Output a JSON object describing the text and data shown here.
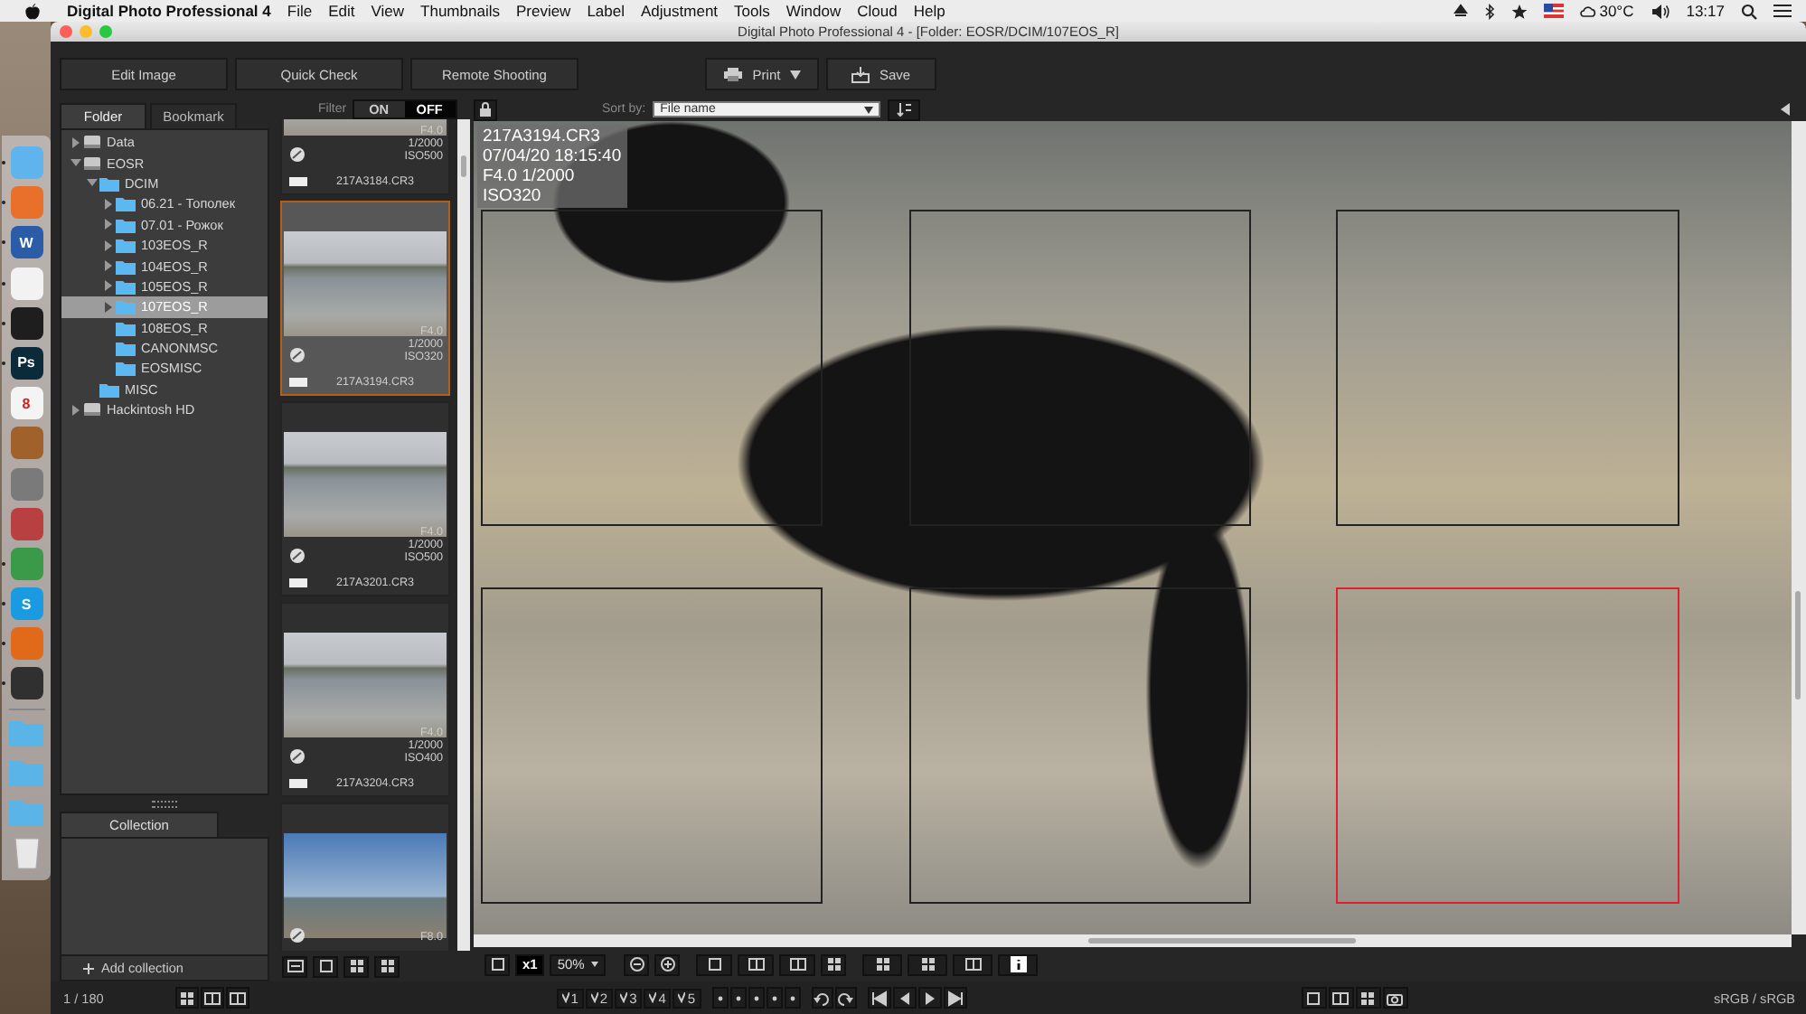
{
  "menubar": {
    "app_name": "Digital Photo Professional 4",
    "items": [
      "File",
      "Edit",
      "View",
      "Thumbnails",
      "Preview",
      "Label",
      "Adjustment",
      "Tools",
      "Window",
      "Cloud",
      "Help"
    ],
    "weather": "30°C",
    "time": "13:17"
  },
  "dock": [
    {
      "kind": "app",
      "color": "#5fb4ee",
      "running": true
    },
    {
      "kind": "app",
      "color": "#e8702a",
      "running": true
    },
    {
      "kind": "app",
      "color": "#2b5ca8",
      "running": true,
      "label": "W"
    },
    {
      "kind": "app",
      "color": "#f2f2f2",
      "running": true
    },
    {
      "kind": "app",
      "color": "#1e1e1e",
      "running": true
    },
    {
      "kind": "app",
      "color": "#0b2b3b",
      "running": true,
      "label": "Ps"
    },
    {
      "kind": "app",
      "color": "#f4f4f4",
      "running": false,
      "label": "8"
    },
    {
      "kind": "app",
      "color": "#a0622a",
      "running": false
    },
    {
      "kind": "app",
      "color": "#7a7a7a",
      "running": false
    },
    {
      "kind": "app",
      "color": "#b84040",
      "running": false
    },
    {
      "kind": "app",
      "color": "#3a9a4a",
      "running": true
    },
    {
      "kind": "app",
      "color": "#1a9ae0",
      "running": true,
      "label": "S"
    },
    {
      "kind": "app",
      "color": "#e06a1a",
      "running": true
    },
    {
      "kind": "app",
      "color": "#303030",
      "running": true
    },
    {
      "kind": "folder",
      "color": "#5ab4e8",
      "running": false
    },
    {
      "kind": "folder",
      "color": "#5ab4e8",
      "running": false
    },
    {
      "kind": "folder",
      "color": "#5ab4e8",
      "running": false
    },
    {
      "kind": "trash",
      "color": "#e8e8e8",
      "running": false
    }
  ],
  "window": {
    "title": "Digital Photo Professional 4 - [Folder: EOSR/DCIM/107EOS_R]"
  },
  "toolbar": {
    "buttons": [
      "Edit Image",
      "Quick Check",
      "Remote Shooting"
    ],
    "print": "Print",
    "save": "Save"
  },
  "sidebar": {
    "tabs": [
      {
        "label": "Folder",
        "selected": true
      },
      {
        "label": "Bookmark",
        "selected": false
      }
    ],
    "tree": [
      {
        "label": "Data",
        "kind": "drive",
        "expandable": true,
        "expanded": false,
        "selected": false
      },
      {
        "label": "EOSR",
        "kind": "drive",
        "expandable": true,
        "expanded": true,
        "selected": false,
        "children": [
          {
            "label": "DCIM",
            "kind": "folder",
            "expandable": true,
            "expanded": true,
            "selected": false,
            "children": [
              {
                "label": "06.21 - Тополек",
                "kind": "folder",
                "expandable": true,
                "expanded": false,
                "selected": false
              },
              {
                "label": "07.01 - Рожок",
                "kind": "folder",
                "expandable": true,
                "expanded": false,
                "selected": false
              },
              {
                "label": "103EOS_R",
                "kind": "folder",
                "expandable": true,
                "expanded": false,
                "selected": false
              },
              {
                "label": "104EOS_R",
                "kind": "folder",
                "expandable": true,
                "expanded": false,
                "selected": false
              },
              {
                "label": "105EOS_R",
                "kind": "folder",
                "expandable": true,
                "expanded": false,
                "selected": false
              },
              {
                "label": "107EOS_R",
                "kind": "folder",
                "expandable": true,
                "expanded": false,
                "selected": true
              },
              {
                "label": "108EOS_R",
                "kind": "folder",
                "expandable": false,
                "selected": false
              },
              {
                "label": "CANONMSC",
                "kind": "folder",
                "expandable": false,
                "selected": false
              },
              {
                "label": "EOSMISC",
                "kind": "folder",
                "expandable": false,
                "selected": false
              }
            ]
          },
          {
            "label": "MISC",
            "kind": "folder",
            "expandable": false,
            "selected": false
          }
        ]
      },
      {
        "label": "Hackintosh HD",
        "kind": "drive",
        "expandable": true,
        "expanded": false,
        "selected": false
      }
    ],
    "collection": {
      "tab": "Collection",
      "add": "Add collection"
    }
  },
  "filter": {
    "label": "Filter",
    "options": [
      {
        "label": "ON",
        "selected": false
      },
      {
        "label": "OFF",
        "selected": true
      }
    ]
  },
  "sort": {
    "label": "Sort by:",
    "value": "File name"
  },
  "thumbnails": [
    {
      "exposure": [
        "F4.0",
        "1/2000",
        "ISO500"
      ],
      "filename": "217A3184.CR3",
      "selected": false
    },
    {
      "exposure": [
        "F4.0",
        "1/2000",
        "ISO320"
      ],
      "filename": "217A3194.CR3",
      "selected": true
    },
    {
      "exposure": [
        "F4.0",
        "1/2000",
        "ISO500"
      ],
      "filename": "217A3201.CR3",
      "selected": false
    },
    {
      "exposure": [
        "F4.0",
        "1/2000",
        "ISO400"
      ],
      "filename": "217A3204.CR3",
      "selected": false
    },
    {
      "exposure": [
        "F8.0"
      ],
      "selected": false
    }
  ],
  "viewer": {
    "info": [
      "217A3194.CR3",
      "07/04/20 18:15:40",
      "F4.0 1/2000",
      "ISO320"
    ],
    "af_points": [
      {
        "selected": false
      },
      {
        "selected": false
      },
      {
        "selected": false
      },
      {
        "selected": false
      },
      {
        "selected": false
      },
      {
        "selected": true
      }
    ],
    "zoom_mode": "x1",
    "zoom": "50%"
  },
  "status_bar": {
    "count": "1 / 180",
    "ratings": [
      "1",
      "2",
      "3",
      "4",
      "5"
    ],
    "color_space": "sRGB / sRGB"
  }
}
